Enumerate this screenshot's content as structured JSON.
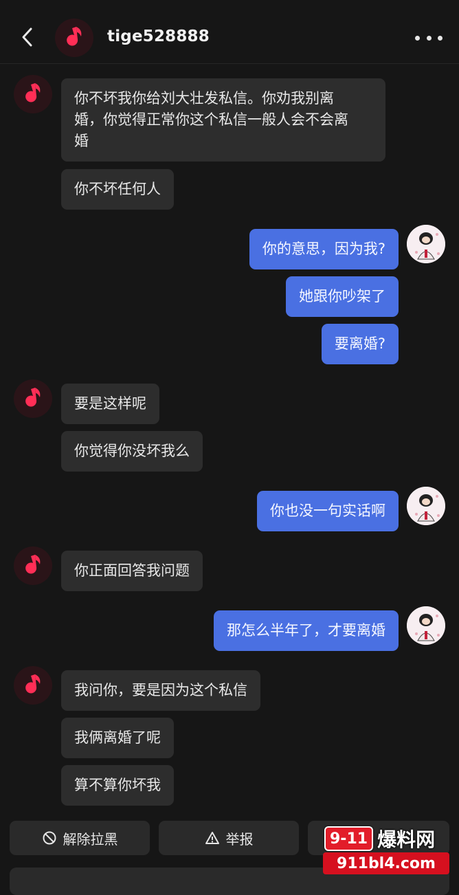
{
  "header": {
    "title": "tige528888",
    "back_icon": "chevron-left-icon",
    "more_icon": "more-dots-icon"
  },
  "messages": [
    {
      "side": "in",
      "text": "你不坏我你给刘大壮发私信。你劝我别离\n婚，你觉得正常你这个私信一般人会不会离\n婚"
    },
    {
      "side": "in",
      "text": "你不坏任何人"
    },
    {
      "side": "out",
      "text": "你的意思，因为我?"
    },
    {
      "side": "out",
      "text": "她跟你吵架了"
    },
    {
      "side": "out",
      "text": "要离婚?"
    },
    {
      "side": "in",
      "text": "要是这样呢"
    },
    {
      "side": "in",
      "text": "你觉得你没坏我么"
    },
    {
      "side": "out",
      "text": "你也没一句实话啊"
    },
    {
      "side": "in",
      "text": "你正面回答我问题"
    },
    {
      "side": "out",
      "text": "那怎么半年了，才要离婚"
    },
    {
      "side": "in",
      "text": "我问你，要是因为这个私信"
    },
    {
      "side": "in",
      "text": "我俩离婚了呢"
    },
    {
      "side": "in",
      "text": "算不算你坏我"
    }
  ],
  "actions": {
    "unblock": "解除拉黑",
    "report": "举报"
  },
  "watermark": {
    "logo": "9-11",
    "cn": "爆料网",
    "url": "911bl4.com"
  },
  "colors": {
    "background": "#161616",
    "incoming_bubble": "#2d2d2d",
    "outgoing_bubble": "#4a70e2",
    "music_icon": "#ff2e56"
  }
}
